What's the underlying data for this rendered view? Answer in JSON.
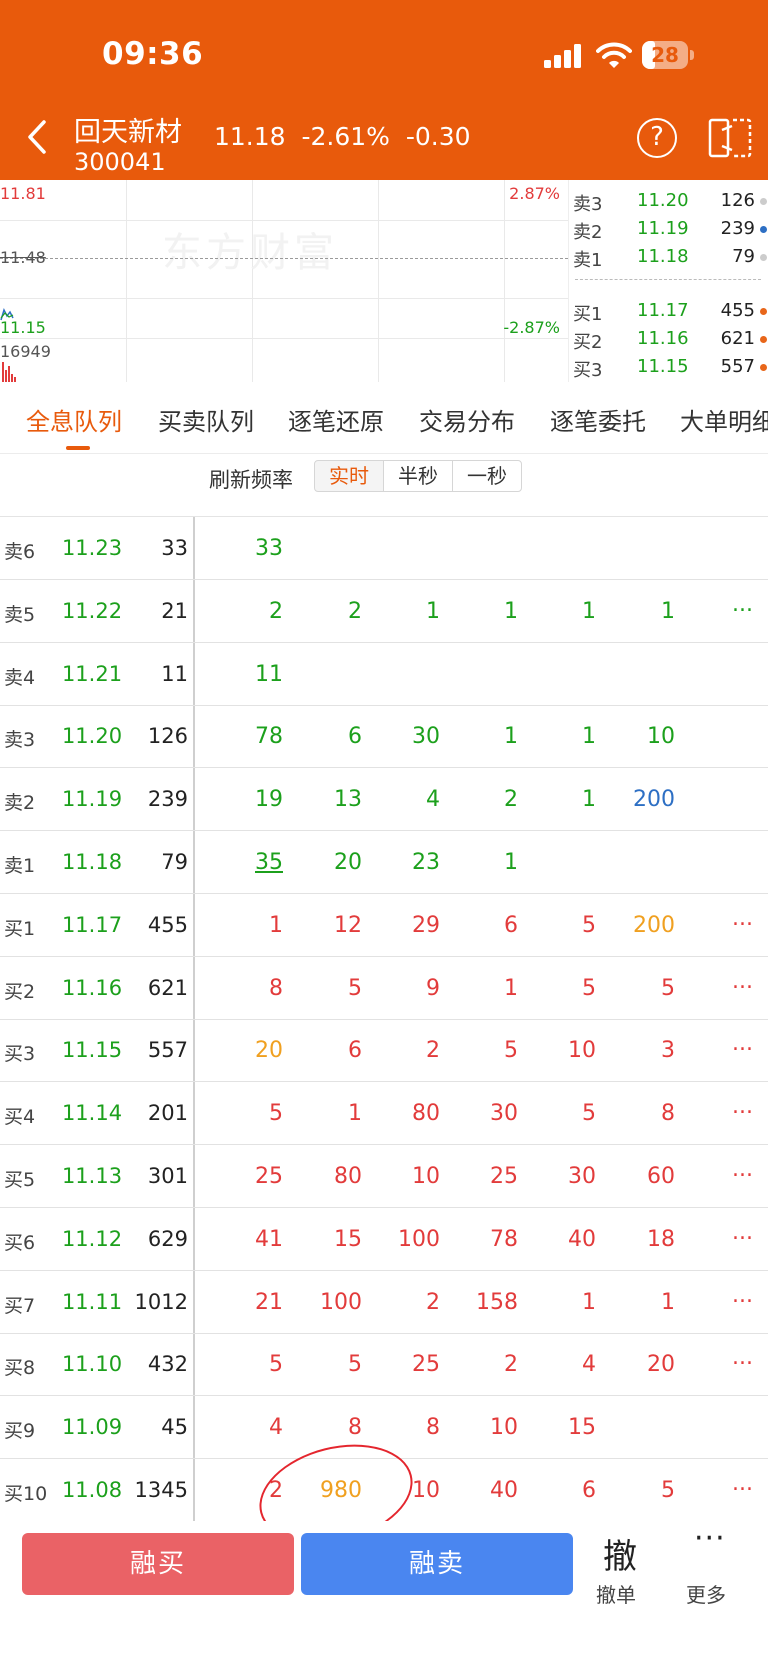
{
  "status_bar": {
    "time": "09:36",
    "battery": "28",
    "battery_pct": 28
  },
  "header": {
    "name": "回天新材",
    "code": "300041",
    "price": "11.18",
    "change_pct": "-2.61%",
    "change": "-0.30"
  },
  "chart": {
    "high": "11.81",
    "mid": "11.48",
    "low": "11.15",
    "high_pct": "2.87%",
    "low_pct": "-2.87%",
    "volume": "16949",
    "watermark": "东方财富"
  },
  "book": [
    {
      "label": "卖3",
      "price": "11.20",
      "vol": "126",
      "dot": "#cccccc"
    },
    {
      "label": "卖2",
      "price": "11.19",
      "vol": "239",
      "dot": "#2d6fc4"
    },
    {
      "label": "卖1",
      "price": "11.18",
      "vol": "79",
      "dot": "#cccccc"
    },
    {
      "label": "买1",
      "price": "11.17",
      "vol": "455",
      "dot": "#e8661a"
    },
    {
      "label": "买2",
      "price": "11.16",
      "vol": "621",
      "dot": "#e8661a"
    },
    {
      "label": "买3",
      "price": "11.15",
      "vol": "557",
      "dot": "#e8661a"
    }
  ],
  "tabs": [
    "全息队列",
    "买卖队列",
    "逐笔还原",
    "交易分布",
    "逐笔委托",
    "大单明细"
  ],
  "refresh": {
    "label": "刷新频率",
    "options": [
      "实时",
      "半秒",
      "一秒"
    ]
  },
  "queue": [
    {
      "level": "卖6",
      "price": "11.23",
      "total": "33",
      "orders": [
        "33"
      ],
      "more": ""
    },
    {
      "level": "卖5",
      "price": "11.22",
      "total": "21",
      "orders": [
        "2",
        "2",
        "1",
        "1",
        "1",
        "1"
      ],
      "more": "..."
    },
    {
      "level": "卖4",
      "price": "11.21",
      "total": "11",
      "orders": [
        "11"
      ],
      "more": ""
    },
    {
      "level": "卖3",
      "price": "11.20",
      "total": "126",
      "orders": [
        "78",
        "6",
        "30",
        "1",
        "1",
        "10"
      ],
      "more": ""
    },
    {
      "level": "卖2",
      "price": "11.19",
      "total": "239",
      "orders": [
        "19",
        "13",
        "4",
        "2",
        "1",
        "200"
      ],
      "more": ""
    },
    {
      "level": "卖1",
      "price": "11.18",
      "total": "79",
      "orders": [
        "35",
        "20",
        "23",
        "1"
      ],
      "more": ""
    },
    {
      "level": "买1",
      "price": "11.17",
      "total": "455",
      "orders": [
        "1",
        "12",
        "29",
        "6",
        "5",
        "200"
      ],
      "more": "..."
    },
    {
      "level": "买2",
      "price": "11.16",
      "total": "621",
      "orders": [
        "8",
        "5",
        "9",
        "1",
        "5",
        "5"
      ],
      "more": "..."
    },
    {
      "level": "买3",
      "price": "11.15",
      "total": "557",
      "orders": [
        "20",
        "6",
        "2",
        "5",
        "10",
        "3"
      ],
      "more": "..."
    },
    {
      "level": "买4",
      "price": "11.14",
      "total": "201",
      "orders": [
        "5",
        "1",
        "80",
        "30",
        "5",
        "8"
      ],
      "more": "..."
    },
    {
      "level": "买5",
      "price": "11.13",
      "total": "301",
      "orders": [
        "25",
        "80",
        "10",
        "25",
        "30",
        "60"
      ],
      "more": "..."
    },
    {
      "level": "买6",
      "price": "11.12",
      "total": "629",
      "orders": [
        "41",
        "15",
        "100",
        "78",
        "40",
        "18"
      ],
      "more": "..."
    },
    {
      "level": "买7",
      "price": "11.11",
      "total": "1012",
      "orders": [
        "21",
        "100",
        "2",
        "158",
        "1",
        "1"
      ],
      "more": "..."
    },
    {
      "level": "买8",
      "price": "11.10",
      "total": "432",
      "orders": [
        "5",
        "5",
        "25",
        "2",
        "4",
        "20"
      ],
      "more": "..."
    },
    {
      "level": "买9",
      "price": "11.09",
      "total": "45",
      "orders": [
        "4",
        "8",
        "8",
        "10",
        "15"
      ],
      "more": ""
    },
    {
      "level": "买10",
      "price": "11.08",
      "total": "1345",
      "orders": [
        "2",
        "980",
        "10",
        "40",
        "6",
        "5"
      ],
      "more": "..."
    }
  ],
  "colors": {
    "brand": "#e85a0c",
    "sell": "#1ca01c",
    "buy": "#e23b3b",
    "large_order": "#f0a020",
    "blue_order": "#2d6fc4"
  },
  "bottom": {
    "buy_label": "融买",
    "sell_label": "融卖",
    "cancel_icon_text": "撤",
    "cancel_label": "撤单",
    "more_icon_text": "···",
    "more_label": "更多"
  }
}
